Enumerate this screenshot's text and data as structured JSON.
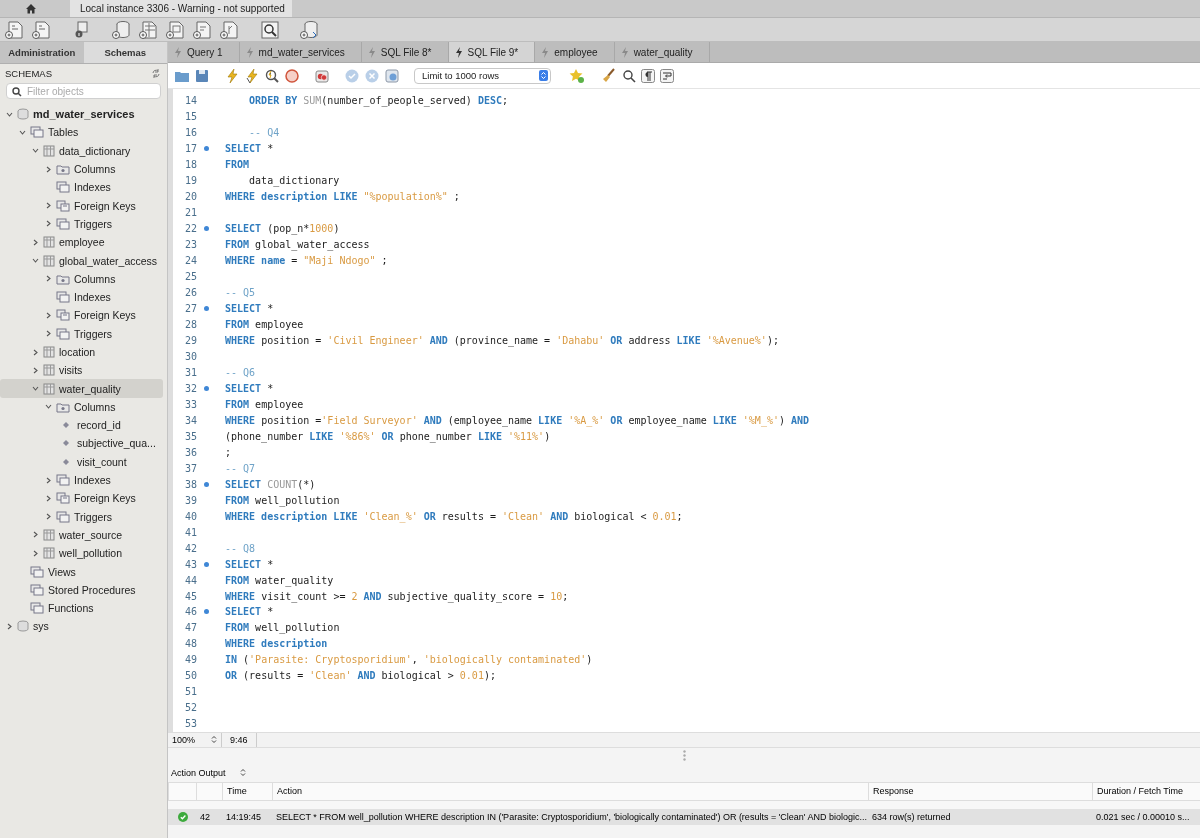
{
  "window": {
    "title": "Local instance 3306 - Warning - not supported"
  },
  "sidebar": {
    "tabs": [
      {
        "label": "Administration",
        "selected": false
      },
      {
        "label": "Schemas",
        "selected": true
      }
    ],
    "heading": "SCHEMAS",
    "filter": {
      "placeholder": "Filter objects"
    },
    "tree": [
      {
        "label": "md_water_services",
        "kind": "database",
        "default_schema": true,
        "expanded": true,
        "selected": false,
        "children": [
          {
            "label": "Tables",
            "kind": "group",
            "expanded": true,
            "selected": false,
            "children": [
              {
                "label": "data_dictionary",
                "kind": "table",
                "expanded": true,
                "selected": false,
                "children": [
                  {
                    "label": "Columns",
                    "kind": "columns",
                    "expanded": false,
                    "selected": false
                  },
                  {
                    "label": "Indexes",
                    "kind": "group",
                    "selected": false
                  },
                  {
                    "label": "Foreign Keys",
                    "kind": "keys",
                    "expanded": false,
                    "selected": false
                  },
                  {
                    "label": "Triggers",
                    "kind": "group",
                    "expanded": false,
                    "selected": false
                  }
                ]
              },
              {
                "label": "employee",
                "kind": "table",
                "expanded": false,
                "selected": false
              },
              {
                "label": "global_water_access",
                "kind": "table",
                "expanded": true,
                "selected": false,
                "children": [
                  {
                    "label": "Columns",
                    "kind": "columns",
                    "expanded": false,
                    "selected": false
                  },
                  {
                    "label": "Indexes",
                    "kind": "group",
                    "selected": false
                  },
                  {
                    "label": "Foreign Keys",
                    "kind": "keys",
                    "expanded": false,
                    "selected": false
                  },
                  {
                    "label": "Triggers",
                    "kind": "group",
                    "expanded": false,
                    "selected": false
                  }
                ]
              },
              {
                "label": "location",
                "kind": "table",
                "expanded": false,
                "selected": false
              },
              {
                "label": "visits",
                "kind": "table",
                "expanded": false,
                "selected": false
              },
              {
                "label": "water_quality",
                "kind": "table",
                "expanded": true,
                "selected": true,
                "children": [
                  {
                    "label": "Columns",
                    "kind": "columns",
                    "expanded": true,
                    "selected": false,
                    "children": [
                      {
                        "label": "record_id",
                        "kind": "column",
                        "selected": false
                      },
                      {
                        "label": "subjective_qua...",
                        "kind": "column",
                        "selected": false
                      },
                      {
                        "label": "visit_count",
                        "kind": "column",
                        "selected": false
                      }
                    ]
                  },
                  {
                    "label": "Indexes",
                    "kind": "group",
                    "expanded": false,
                    "selected": false
                  },
                  {
                    "label": "Foreign Keys",
                    "kind": "keys",
                    "expanded": false,
                    "selected": false
                  },
                  {
                    "label": "Triggers",
                    "kind": "group",
                    "expanded": false,
                    "selected": false
                  }
                ]
              },
              {
                "label": "water_source",
                "kind": "table",
                "expanded": false,
                "selected": false
              },
              {
                "label": "well_pollution",
                "kind": "table",
                "expanded": false,
                "selected": false
              }
            ]
          },
          {
            "label": "Views",
            "kind": "group",
            "selected": false
          },
          {
            "label": "Stored Procedures",
            "kind": "group",
            "selected": false
          },
          {
            "label": "Functions",
            "kind": "group",
            "selected": false
          }
        ]
      },
      {
        "label": "sys",
        "kind": "database",
        "default_schema": false,
        "expanded": false,
        "selected": false
      }
    ]
  },
  "editor": {
    "tabs": [
      {
        "label": "Query 1",
        "selected": false
      },
      {
        "label": "md_water_services",
        "selected": false
      },
      {
        "label": "SQL File 8*",
        "selected": false
      },
      {
        "label": "SQL File 9*",
        "selected": true
      },
      {
        "label": "employee",
        "selected": false
      },
      {
        "label": "water_quality",
        "selected": false
      }
    ],
    "row_limit": "Limit to 1000 rows",
    "lines": [
      {
        "number": "14",
        "marker": false,
        "tokens": [
          {
            "kind": "keyword",
            "text": "    ORDER BY "
          },
          {
            "kind": "function",
            "text": "SUM"
          },
          {
            "kind": "plain",
            "text": "(number_of_people_served) "
          },
          {
            "kind": "keyword",
            "text": "DESC"
          },
          {
            "kind": "plain",
            "text": ";"
          }
        ]
      },
      {
        "number": "15",
        "marker": false
      },
      {
        "number": "16",
        "marker": false,
        "tokens": [
          {
            "kind": "comment",
            "text": "    -- Q4"
          }
        ]
      },
      {
        "number": "17",
        "marker": true,
        "tokens": [
          {
            "kind": "keyword",
            "text": "SELECT"
          },
          {
            "kind": "plain",
            "text": " *"
          }
        ]
      },
      {
        "number": "18",
        "marker": false,
        "tokens": [
          {
            "kind": "keyword",
            "text": "FROM"
          }
        ]
      },
      {
        "number": "19",
        "marker": false,
        "tokens": [
          {
            "kind": "plain",
            "text": "    data_dictionary"
          }
        ]
      },
      {
        "number": "20",
        "marker": false,
        "tokens": [
          {
            "kind": "keyword",
            "text": "WHERE description LIKE "
          },
          {
            "kind": "string",
            "text": "\"%population%\""
          },
          {
            "kind": "plain",
            "text": " ;"
          }
        ]
      },
      {
        "number": "21",
        "marker": false
      },
      {
        "number": "22",
        "marker": true,
        "tokens": [
          {
            "kind": "keyword",
            "text": "SELECT"
          },
          {
            "kind": "plain",
            "text": " (pop_n*"
          },
          {
            "kind": "number",
            "text": "1000"
          },
          {
            "kind": "plain",
            "text": ")"
          }
        ]
      },
      {
        "number": "23",
        "marker": false,
        "tokens": [
          {
            "kind": "keyword",
            "text": "FROM"
          },
          {
            "kind": "plain",
            "text": " global_water_access"
          }
        ]
      },
      {
        "number": "24",
        "marker": false,
        "tokens": [
          {
            "kind": "keyword",
            "text": "WHERE name"
          },
          {
            "kind": "plain",
            "text": " = "
          },
          {
            "kind": "string",
            "text": "\"Maji Ndogo\""
          },
          {
            "kind": "plain",
            "text": " ;"
          }
        ]
      },
      {
        "number": "25",
        "marker": false
      },
      {
        "number": "26",
        "marker": false,
        "tokens": [
          {
            "kind": "comment",
            "text": "-- Q5"
          }
        ]
      },
      {
        "number": "27",
        "marker": true,
        "tokens": [
          {
            "kind": "keyword",
            "text": "SELECT"
          },
          {
            "kind": "plain",
            "text": " *"
          }
        ]
      },
      {
        "number": "28",
        "marker": false,
        "tokens": [
          {
            "kind": "keyword",
            "text": "FROM"
          },
          {
            "kind": "plain",
            "text": " employee"
          }
        ]
      },
      {
        "number": "29",
        "marker": false,
        "tokens": [
          {
            "kind": "keyword",
            "text": "WHERE"
          },
          {
            "kind": "plain",
            "text": " position = "
          },
          {
            "kind": "string",
            "text": "'Civil Engineer' "
          },
          {
            "kind": "keyword",
            "text": "AND"
          },
          {
            "kind": "plain",
            "text": " (province_name = "
          },
          {
            "kind": "string",
            "text": "'Dahabu' "
          },
          {
            "kind": "keyword",
            "text": "OR"
          },
          {
            "kind": "plain",
            "text": " address "
          },
          {
            "kind": "keyword",
            "text": "LIKE "
          },
          {
            "kind": "string",
            "text": "'%Avenue%'"
          },
          {
            "kind": "plain",
            "text": ");"
          }
        ]
      },
      {
        "number": "30",
        "marker": false
      },
      {
        "number": "31",
        "marker": false,
        "tokens": [
          {
            "kind": "comment",
            "text": "-- Q6"
          }
        ]
      },
      {
        "number": "32",
        "marker": true,
        "tokens": [
          {
            "kind": "keyword",
            "text": "SELECT"
          },
          {
            "kind": "plain",
            "text": " *"
          }
        ]
      },
      {
        "number": "33",
        "marker": false,
        "tokens": [
          {
            "kind": "keyword",
            "text": "FROM"
          },
          {
            "kind": "plain",
            "text": " employee"
          }
        ]
      },
      {
        "number": "34",
        "marker": false,
        "tokens": [
          {
            "kind": "keyword",
            "text": "WHERE"
          },
          {
            "kind": "plain",
            "text": " position ="
          },
          {
            "kind": "string",
            "text": "'Field Surveyor' "
          },
          {
            "kind": "keyword",
            "text": "AND"
          },
          {
            "kind": "plain",
            "text": " (employee_name "
          },
          {
            "kind": "keyword",
            "text": "LIKE "
          },
          {
            "kind": "string",
            "text": "'%A_%' "
          },
          {
            "kind": "keyword",
            "text": "OR"
          },
          {
            "kind": "plain",
            "text": " employee_name "
          },
          {
            "kind": "keyword",
            "text": "LIKE "
          },
          {
            "kind": "string",
            "text": "'%M_%'"
          },
          {
            "kind": "plain",
            "text": ") "
          },
          {
            "kind": "keyword",
            "text": "AND"
          }
        ]
      },
      {
        "number": "35",
        "marker": false,
        "tokens": [
          {
            "kind": "plain",
            "text": "(phone_number "
          },
          {
            "kind": "keyword",
            "text": "LIKE "
          },
          {
            "kind": "string",
            "text": "'%86%' "
          },
          {
            "kind": "keyword",
            "text": "OR"
          },
          {
            "kind": "plain",
            "text": " phone_number "
          },
          {
            "kind": "keyword",
            "text": "LIKE "
          },
          {
            "kind": "string",
            "text": "'%11%'"
          },
          {
            "kind": "plain",
            "text": ")"
          }
        ]
      },
      {
        "number": "36",
        "marker": false,
        "tokens": [
          {
            "kind": "plain",
            "text": ";"
          }
        ]
      },
      {
        "number": "37",
        "marker": false,
        "tokens": [
          {
            "kind": "comment",
            "text": "-- Q7"
          }
        ]
      },
      {
        "number": "38",
        "marker": true,
        "tokens": [
          {
            "kind": "keyword",
            "text": "SELECT "
          },
          {
            "kind": "function",
            "text": "COUNT"
          },
          {
            "kind": "plain",
            "text": "(*)"
          }
        ]
      },
      {
        "number": "39",
        "marker": false,
        "tokens": [
          {
            "kind": "keyword",
            "text": "FROM"
          },
          {
            "kind": "plain",
            "text": " well_pollution"
          }
        ]
      },
      {
        "number": "40",
        "marker": false,
        "tokens": [
          {
            "kind": "keyword",
            "text": "WHERE description LIKE "
          },
          {
            "kind": "string",
            "text": "'Clean_%' "
          },
          {
            "kind": "keyword",
            "text": "OR"
          },
          {
            "kind": "plain",
            "text": " results = "
          },
          {
            "kind": "string",
            "text": "'Clean' "
          },
          {
            "kind": "keyword",
            "text": "AND"
          },
          {
            "kind": "plain",
            "text": " biological < "
          },
          {
            "kind": "number",
            "text": "0.01"
          },
          {
            "kind": "plain",
            "text": ";"
          }
        ]
      },
      {
        "number": "41",
        "marker": false
      },
      {
        "number": "42",
        "marker": false,
        "tokens": [
          {
            "kind": "comment",
            "text": "-- Q8"
          }
        ]
      },
      {
        "number": "43",
        "marker": true,
        "tokens": [
          {
            "kind": "keyword",
            "text": "SELECT"
          },
          {
            "kind": "plain",
            "text": " *"
          }
        ]
      },
      {
        "number": "44",
        "marker": false,
        "tokens": [
          {
            "kind": "keyword",
            "text": "FROM"
          },
          {
            "kind": "plain",
            "text": " water_quality"
          }
        ]
      },
      {
        "number": "45",
        "marker": false,
        "tokens": [
          {
            "kind": "keyword",
            "text": "WHERE"
          },
          {
            "kind": "plain",
            "text": " visit_count >= "
          },
          {
            "kind": "number",
            "text": "2 "
          },
          {
            "kind": "keyword",
            "text": "AND"
          },
          {
            "kind": "plain",
            "text": " subjective_quality_score = "
          },
          {
            "kind": "number",
            "text": "10"
          },
          {
            "kind": "plain",
            "text": ";"
          }
        ]
      },
      {
        "number": "46",
        "marker": true,
        "tokens": [
          {
            "kind": "keyword",
            "text": "SELECT"
          },
          {
            "kind": "plain",
            "text": " *"
          }
        ]
      },
      {
        "number": "47",
        "marker": false,
        "tokens": [
          {
            "kind": "keyword",
            "text": "FROM"
          },
          {
            "kind": "plain",
            "text": " well_pollution"
          }
        ]
      },
      {
        "number": "48",
        "marker": false,
        "tokens": [
          {
            "kind": "keyword",
            "text": "WHERE description"
          }
        ]
      },
      {
        "number": "49",
        "marker": false,
        "tokens": [
          {
            "kind": "keyword",
            "text": "IN"
          },
          {
            "kind": "plain",
            "text": " ("
          },
          {
            "kind": "string",
            "text": "'Parasite: Cryptosporidium'"
          },
          {
            "kind": "plain",
            "text": ", "
          },
          {
            "kind": "string",
            "text": "'biologically contaminated'"
          },
          {
            "kind": "plain",
            "text": ")"
          }
        ]
      },
      {
        "number": "50",
        "marker": false,
        "tokens": [
          {
            "kind": "keyword",
            "text": "OR"
          },
          {
            "kind": "plain",
            "text": " (results = "
          },
          {
            "kind": "string",
            "text": "'Clean' "
          },
          {
            "kind": "keyword",
            "text": "AND"
          },
          {
            "kind": "plain",
            "text": " biological > "
          },
          {
            "kind": "number",
            "text": "0.01"
          },
          {
            "kind": "plain",
            "text": ");"
          }
        ]
      },
      {
        "number": "51",
        "marker": false
      },
      {
        "number": "52",
        "marker": false
      },
      {
        "number": "53",
        "marker": false
      }
    ],
    "status": {
      "zoom": "100%",
      "cursor": "9:46"
    }
  },
  "output": {
    "selector": "Action Output",
    "columns": [
      "Time",
      "Action",
      "Response",
      "Duration / Fetch Time"
    ],
    "rows": [
      {
        "succeeded": true,
        "number": "42",
        "time": "14:19:45",
        "action": "SELECT * FROM well_pollution WHERE description IN ('Parasite: Cryptosporidium', 'biologically contaminated') OR (results = 'Clean' AND biologic...",
        "response": "634 row(s) returned",
        "duration": "0.021 sec / 0.00010 s..."
      }
    ]
  }
}
